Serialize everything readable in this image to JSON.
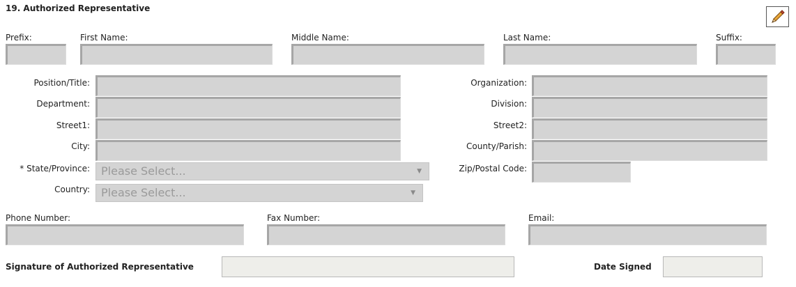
{
  "section": {
    "title": "19. Authorized Representative"
  },
  "name_row": {
    "prefix_label": "Prefix:",
    "first_label": "First Name:",
    "middle_label": "Middle Name:",
    "last_label": "Last Name:",
    "suffix_label": "Suffix:"
  },
  "address": {
    "position_label": "Position/Title:",
    "department_label": "Department:",
    "street1_label": "Street1:",
    "city_label": "City:",
    "state_label": "* State/Province:",
    "state_value": "Please Select...",
    "country_label": "Country:",
    "country_value": "Please Select...",
    "organization_label": "Organization:",
    "division_label": "Division:",
    "street2_label": "Street2:",
    "county_label": "County/Parish:",
    "zip_label": "Zip/Postal Code:"
  },
  "contact": {
    "phone_label": "Phone Number:",
    "fax_label": "Fax Number:",
    "email_label": "Email:"
  },
  "signature": {
    "signature_label": "Signature of Authorized Representative",
    "date_label": "Date Signed"
  },
  "icons": {
    "edit": "pencil-icon",
    "dropdown": "triangle-down-icon"
  }
}
